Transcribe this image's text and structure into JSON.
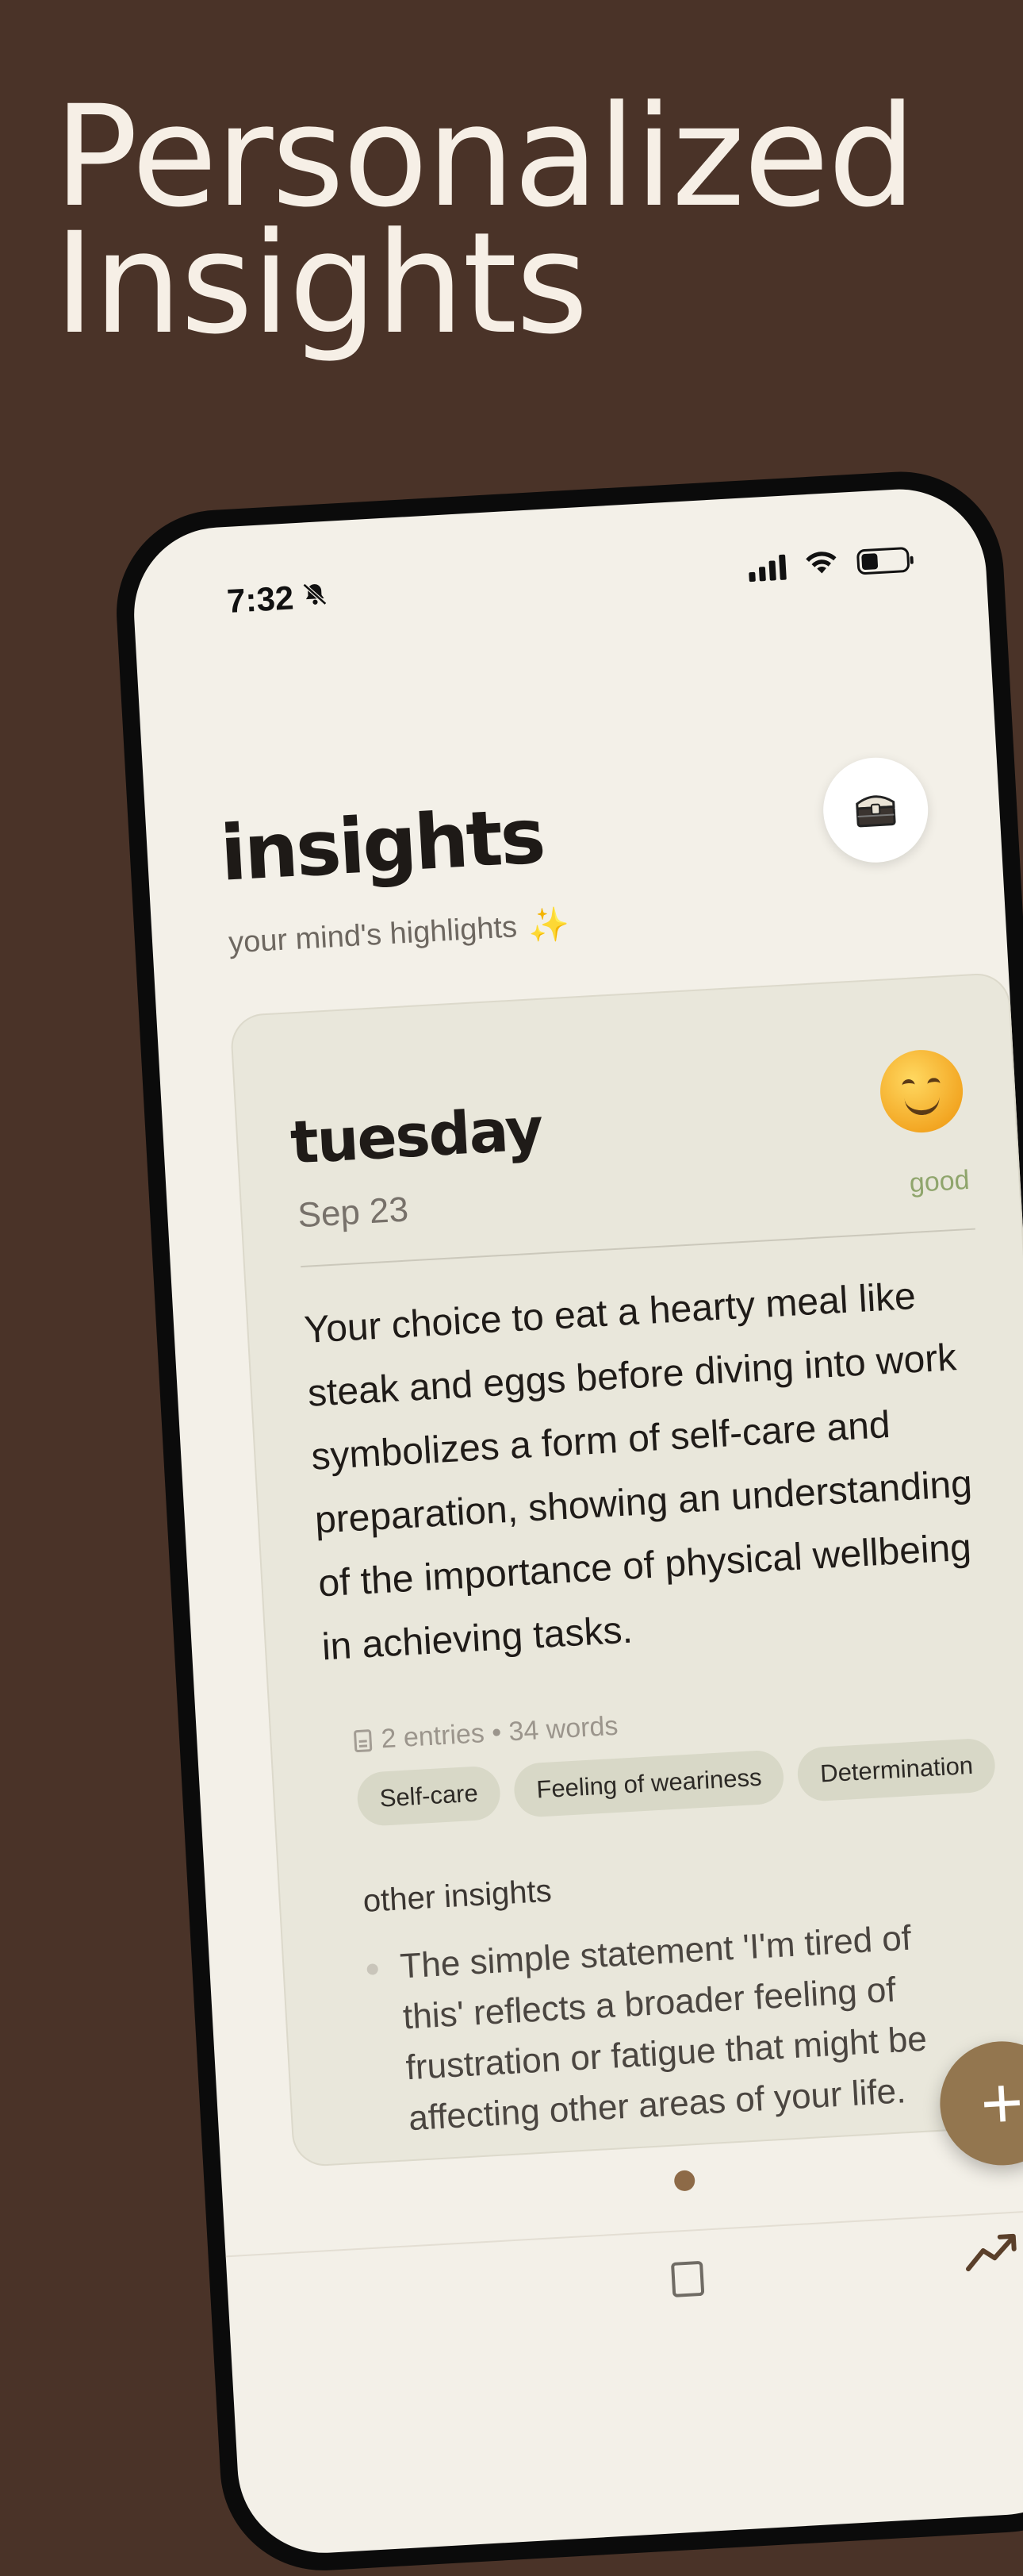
{
  "headline": {
    "line1": "Personalized",
    "line2": "Insights"
  },
  "status_bar": {
    "time": "7:32",
    "icons": [
      "bell-slash-icon",
      "signal-icon",
      "wifi-icon",
      "battery-icon"
    ]
  },
  "page": {
    "title": "insights",
    "subtitle": "your mind's highlights",
    "subtitle_emoji": "✨",
    "journal_icon": "treasure-chest-icon"
  },
  "insight_card": {
    "day": "tuesday",
    "date": "Sep 23",
    "mood_emoji": "smiling-face-icon",
    "mood_label": "good",
    "text": "Your choice to eat a hearty meal like steak and eggs before diving into work symbolizes a form of self-care and preparation, showing an understanding of the importance of physical wellbeing in achieving tasks.",
    "meta": "2 entries • 34 words",
    "tags": [
      "Self-care",
      "Feeling of weariness",
      "Determination"
    ],
    "other_insights_title": "other insights",
    "other_insights": [
      "The simple statement 'I'm tired of this' reflects a broader feeling of frustration or fatigue that might be affecting other areas of your life."
    ]
  },
  "fab": {
    "label": "+"
  },
  "colors": {
    "background": "#4a3328",
    "screen": "#f3f0e8",
    "card": "#e9e7db",
    "accent": "#93764f",
    "mood_good": "#8fa56c"
  }
}
